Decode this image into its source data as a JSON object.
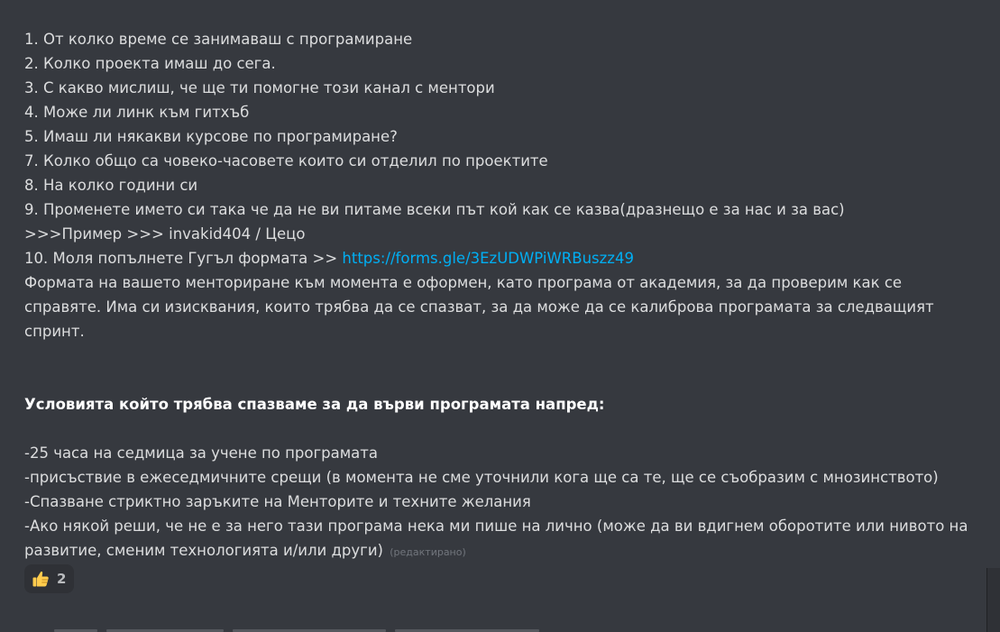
{
  "message": {
    "lines": [
      "1. От колко време се занимаваш с програмиране",
      "2. Колко проекта имаш до сега.",
      "3. С какво мислиш, че ще ти помогне този канал с ментори",
      "4. Може ли линк към гитхъб",
      "5. Имаш ли някакви курсове по програмиране?",
      "7. Колко общо са човеко-часовете които си отделил по проектите",
      "8. На колко години си",
      "9. Променете името си така че да не ви питаме всеки път кой как се казва(дразнещо е за нас и за вас)",
      ">>>Пример >>> invakid404 / Цецо"
    ],
    "line10_prefix": "10. Моля попълнете Гугъл формата >> ",
    "line10_link": "https://forms.gle/3EzUDWPiWRBuszz49",
    "paragraph": "Формата на вашето менториране към момента е оформен, като програма от академия, за да проверим как се справяте. Има си изисквания, които трябва да се спазват, за да може да се калиброва програмата за следващият спринт.",
    "conditions_heading": "Условията който трябва спазваме за да върви програмата напред:",
    "conditions": [
      "-25 часа на седмица за учене по програмата",
      "-присъствие в ежеседмичните срещи (в момента не сме уточнили кога ще са те, ще се съобразим с мнозинството)",
      "-Спазване стриктно заръките на Менторите и техните желания"
    ],
    "last_condition": "-Ако някой реши, че не е за него тази програма нека ми пише на лично (може да ви вдигнем оборотите или нивото на развитие, сменим технологията и/или други)",
    "edited_label": "(редактирано)"
  },
  "reaction": {
    "icon": "thumbs-up-icon",
    "count": "2",
    "color": "#ffcc4d"
  },
  "colors": {
    "background": "#36393f",
    "text": "#dcddde",
    "link": "#00aff4",
    "muted": "#72767d"
  }
}
